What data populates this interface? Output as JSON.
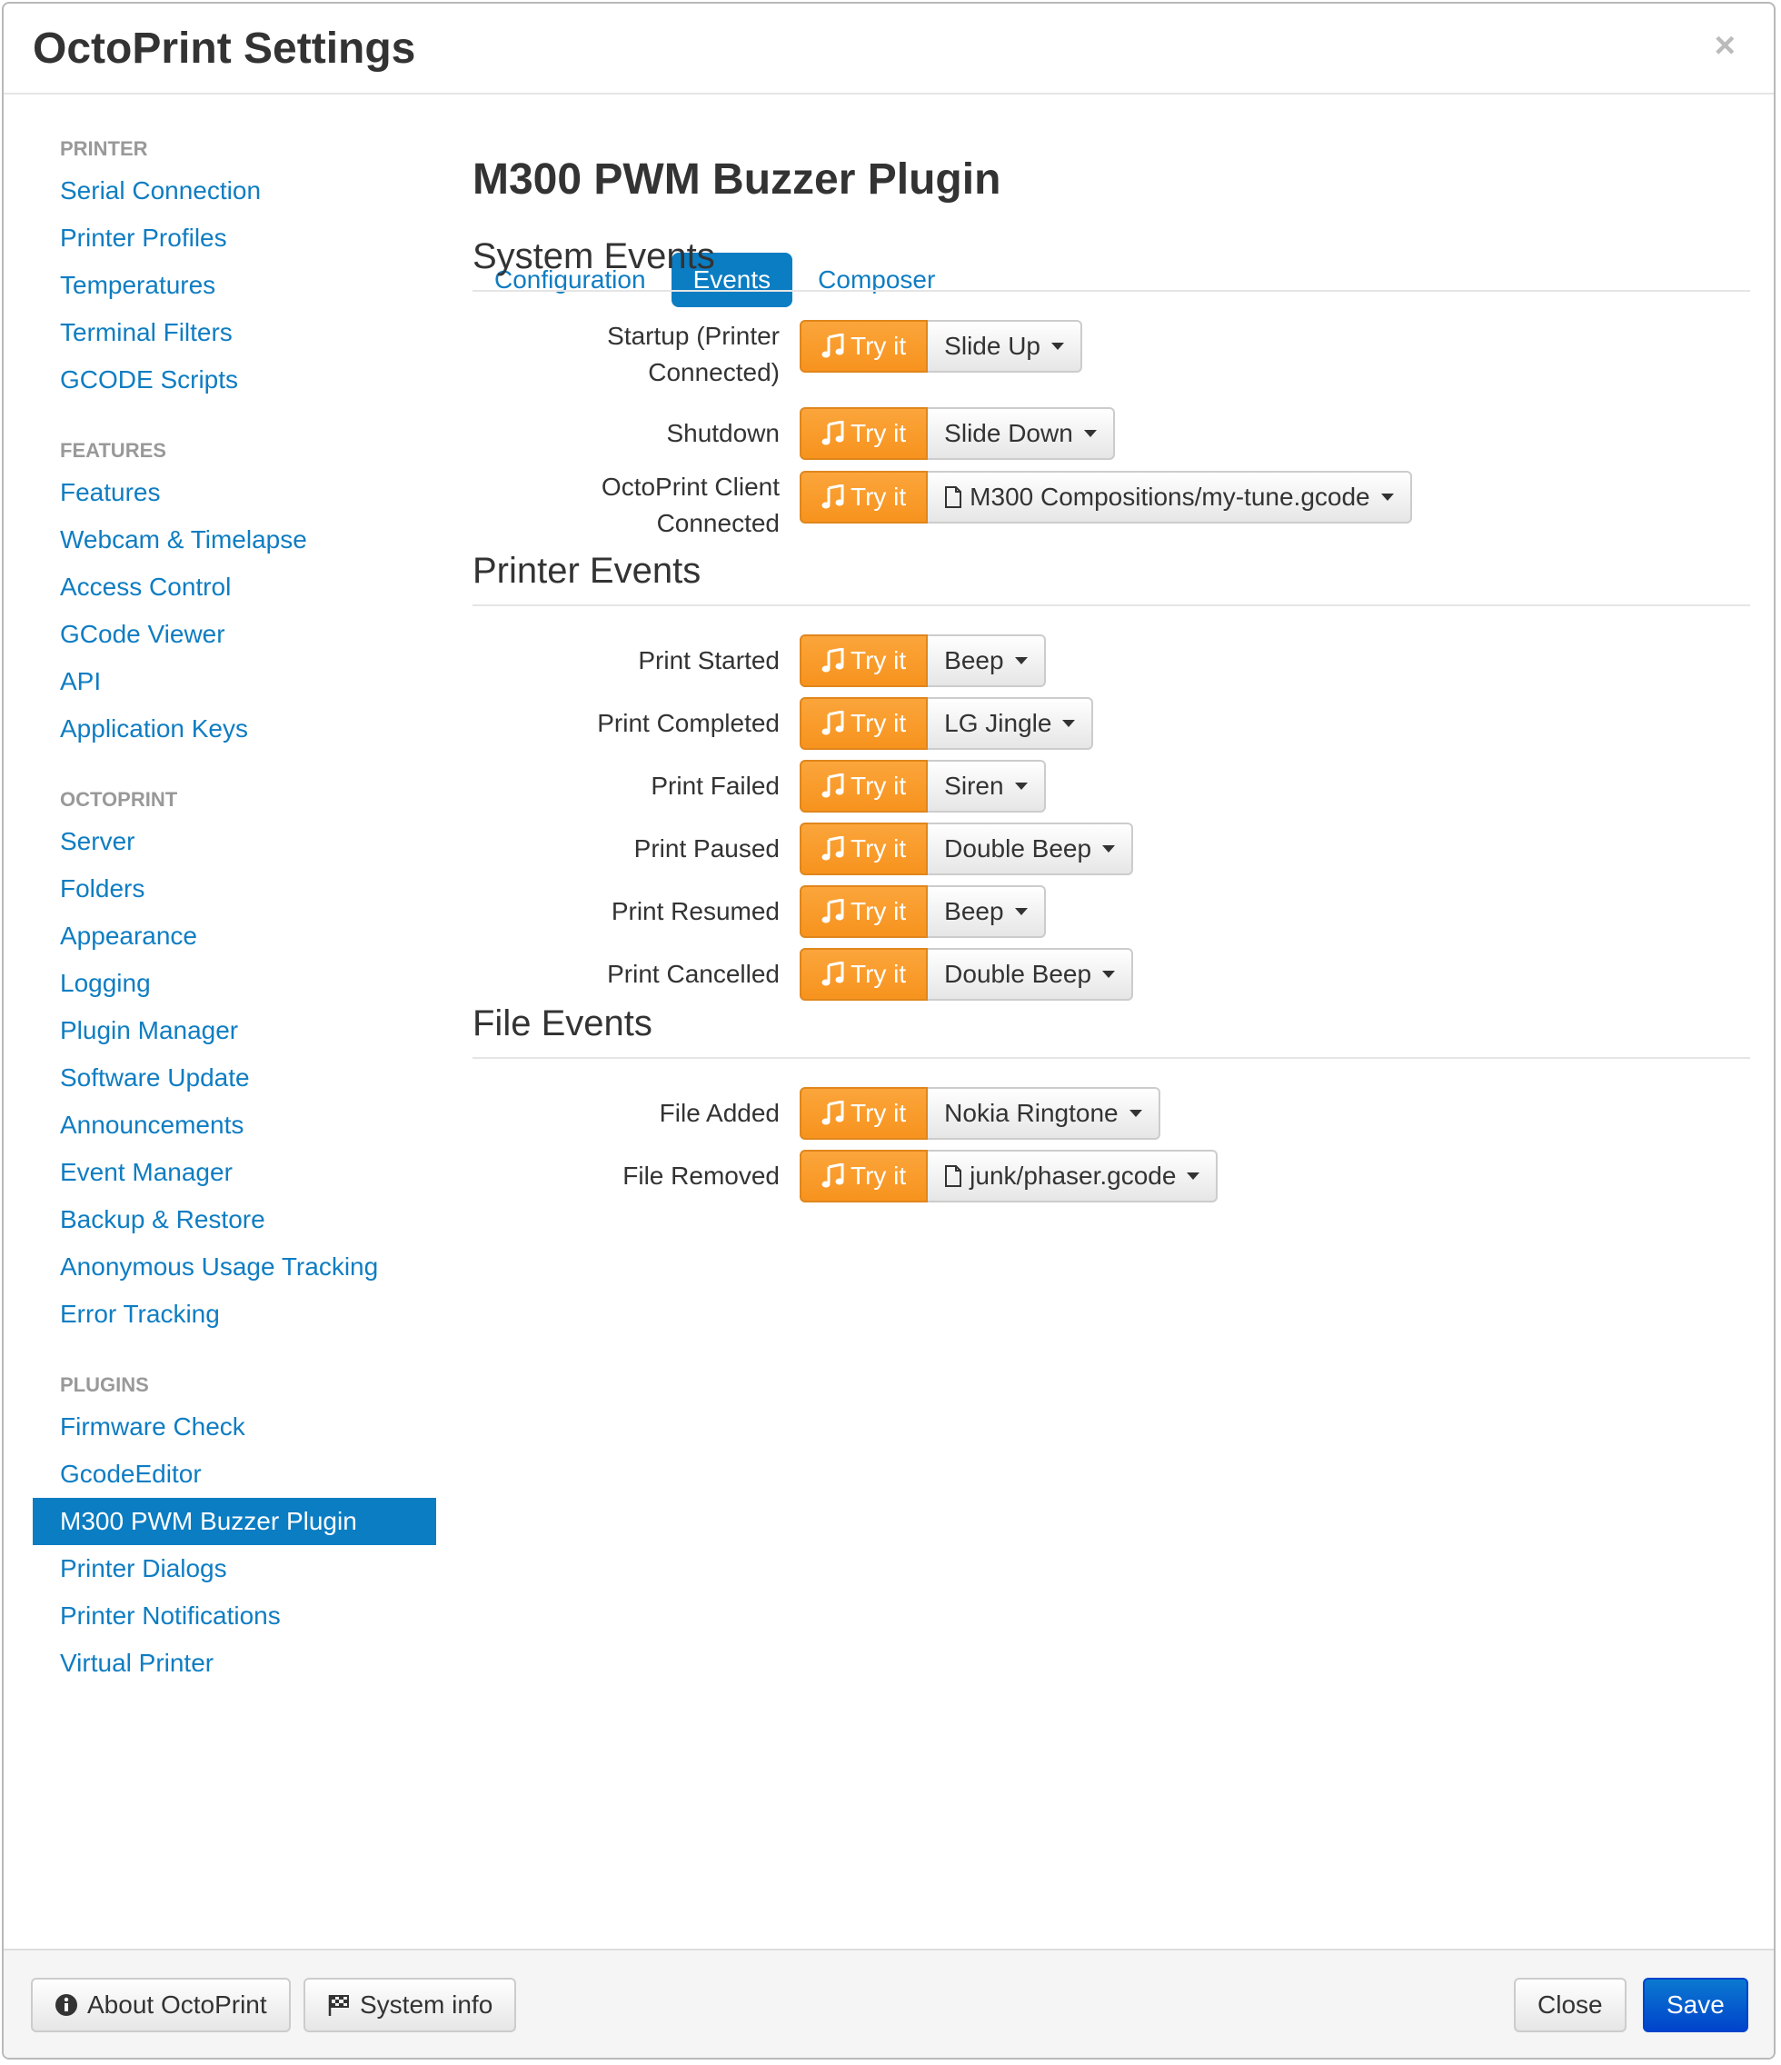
{
  "dialog": {
    "title": "OctoPrint Settings",
    "close_label": "×"
  },
  "sidebar": {
    "groups": [
      {
        "header": "PRINTER",
        "items": [
          "Serial Connection",
          "Printer Profiles",
          "Temperatures",
          "Terminal Filters",
          "GCODE Scripts"
        ]
      },
      {
        "header": "FEATURES",
        "items": [
          "Features",
          "Webcam & Timelapse",
          "Access Control",
          "GCode Viewer",
          "API",
          "Application Keys"
        ]
      },
      {
        "header": "OCTOPRINT",
        "items": [
          "Server",
          "Folders",
          "Appearance",
          "Logging",
          "Plugin Manager",
          "Software Update",
          "Announcements",
          "Event Manager",
          "Backup & Restore",
          "Anonymous Usage Tracking",
          "Error Tracking"
        ]
      },
      {
        "header": "PLUGINS",
        "items": [
          "Firmware Check",
          "GcodeEditor",
          "M300 PWM Buzzer Plugin",
          "Printer Dialogs",
          "Printer Notifications",
          "Virtual Printer"
        ]
      }
    ],
    "active_item": "M300 PWM Buzzer Plugin"
  },
  "main": {
    "title": "M300 PWM Buzzer Plugin",
    "tabs": [
      {
        "label": "Configuration",
        "active": false
      },
      {
        "label": "Events",
        "active": true
      },
      {
        "label": "Composer",
        "active": false
      }
    ],
    "try_label": "Try it",
    "sections": [
      {
        "title": "System Events",
        "rows": [
          {
            "label_lines": [
              "Startup (Printer",
              "Connected)"
            ],
            "value": "Slide Up",
            "is_file": false
          },
          {
            "label_lines": [
              "Shutdown"
            ],
            "value": "Slide Down",
            "is_file": false
          },
          {
            "label_lines": [
              "OctoPrint Client",
              "Connected"
            ],
            "value": "M300 Compositions/my-tune.gcode",
            "is_file": true
          }
        ]
      },
      {
        "title": "Printer Events",
        "rows": [
          {
            "label_lines": [
              "Print Started"
            ],
            "value": "Beep",
            "is_file": false
          },
          {
            "label_lines": [
              "Print Completed"
            ],
            "value": "LG Jingle",
            "is_file": false
          },
          {
            "label_lines": [
              "Print Failed"
            ],
            "value": "Siren",
            "is_file": false
          },
          {
            "label_lines": [
              "Print Paused"
            ],
            "value": "Double Beep",
            "is_file": false
          },
          {
            "label_lines": [
              "Print Resumed"
            ],
            "value": "Beep",
            "is_file": false
          },
          {
            "label_lines": [
              "Print Cancelled"
            ],
            "value": "Double Beep",
            "is_file": false
          }
        ]
      },
      {
        "title": "File Events",
        "rows": [
          {
            "label_lines": [
              "File Added"
            ],
            "value": "Nokia Ringtone",
            "is_file": false
          },
          {
            "label_lines": [
              "File Removed"
            ],
            "value": "junk/phaser.gcode",
            "is_file": true
          }
        ]
      }
    ]
  },
  "footer": {
    "about_label": "About OctoPrint",
    "sysinfo_label": "System info",
    "close_label": "Close",
    "save_label": "Save"
  },
  "colors": {
    "accent": "#0b7dc3",
    "try_button": "#f7931e",
    "save_button": "#0044cc"
  }
}
